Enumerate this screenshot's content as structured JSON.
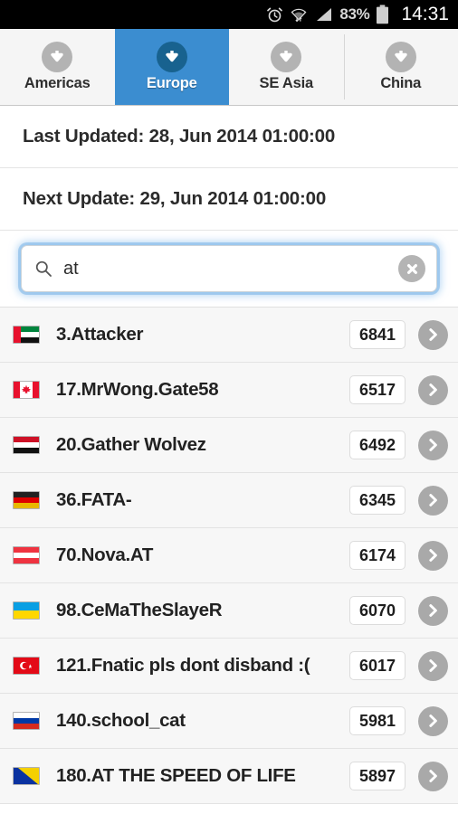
{
  "statusbar": {
    "alarm_icon": "alarm-clock-icon",
    "wifi_icon": "wifi-icon",
    "signal_icon": "signal-icon",
    "battery_percent": "83%",
    "battery_icon": "battery-icon",
    "time": "14:31"
  },
  "tabs": [
    {
      "label": "Americas",
      "icon": "download-circle-icon",
      "active": false
    },
    {
      "label": "Europe",
      "icon": "download-circle-icon",
      "active": true
    },
    {
      "label": "SE Asia",
      "icon": "download-circle-icon",
      "active": false
    },
    {
      "label": "China",
      "icon": "download-circle-icon",
      "active": false
    }
  ],
  "updates": {
    "last": "Last Updated: 28, Jun 2014 01:00:00",
    "next": "Next Update: 29, Jun 2014 01:00:00"
  },
  "search": {
    "icon": "search-icon",
    "value": "at",
    "placeholder": "",
    "clear_icon": "clear-circle-icon"
  },
  "list": {
    "chevron_icon": "chevron-right-icon",
    "rows": [
      {
        "flag": "ae",
        "name": "3.Attacker",
        "score": "6841"
      },
      {
        "flag": "ca",
        "name": "17.MrWong.Gate58",
        "score": "6517"
      },
      {
        "flag": "ye",
        "name": "20.Gather Wolvez",
        "score": "6492"
      },
      {
        "flag": "de",
        "name": "36.FATA-",
        "score": "6345"
      },
      {
        "flag": "at",
        "name": "70.Nova.AT",
        "score": "6174"
      },
      {
        "flag": "ua",
        "name": "98.CeMaTheSlayeR",
        "score": "6070"
      },
      {
        "flag": "tr",
        "name": "121.Fnatic pls dont disband :(",
        "score": "6017"
      },
      {
        "flag": "ru",
        "name": "140.school_cat",
        "score": "5981"
      },
      {
        "flag": "ba",
        "name": "180.AT THE SPEED OF LIFE",
        "score": "5897"
      }
    ]
  },
  "colors": {
    "accent": "#3b8dd0",
    "accent_dark": "#18628f",
    "status_bg": "#000000",
    "list_bg": "#f7f7f7"
  }
}
